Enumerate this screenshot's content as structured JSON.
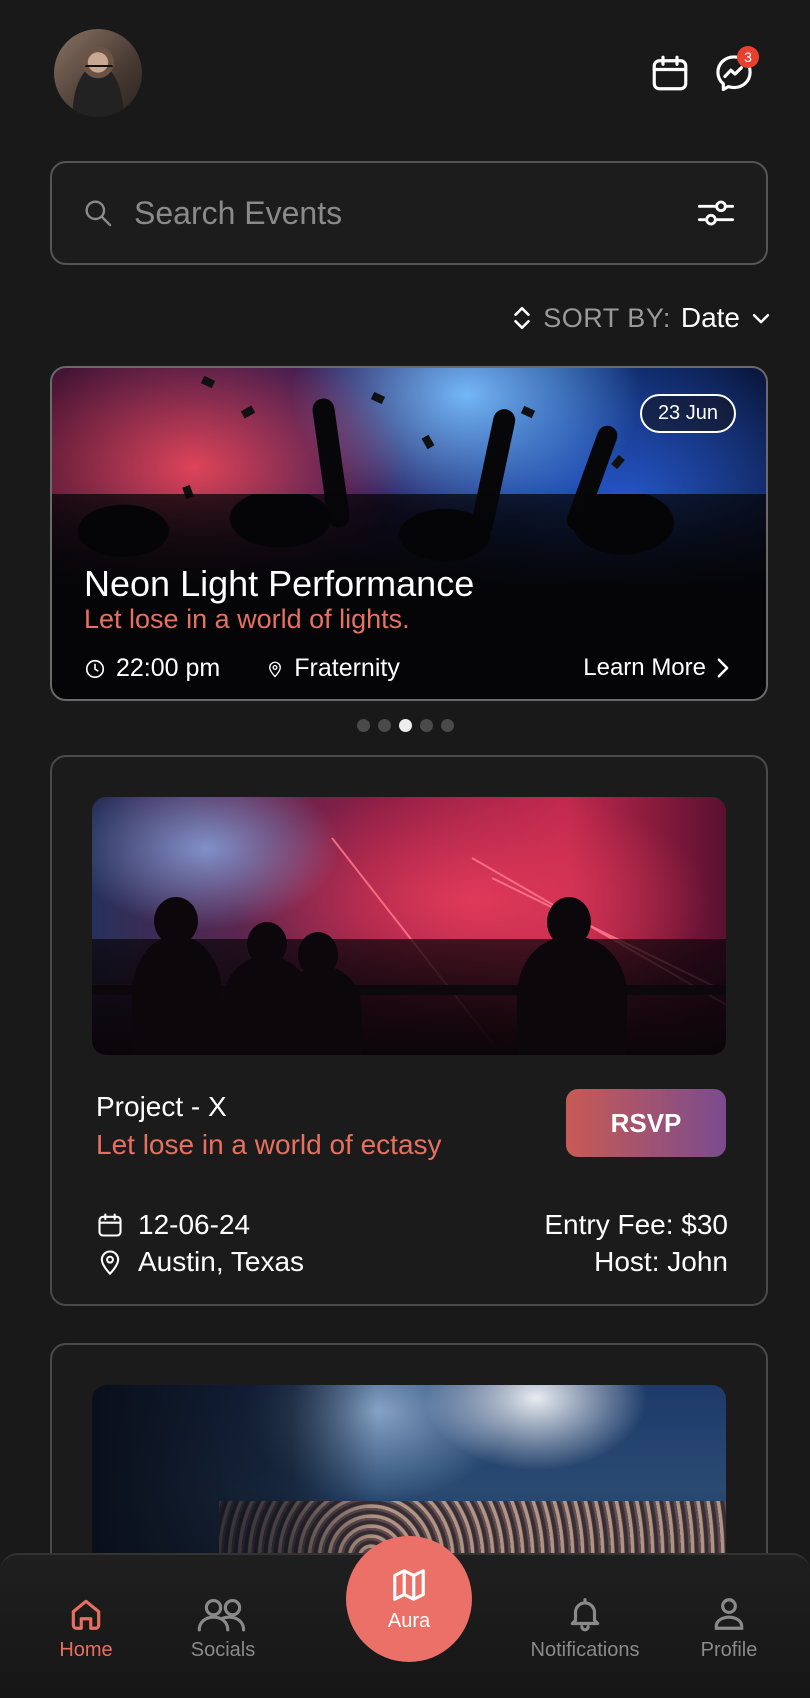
{
  "header": {
    "avatar_alt": "user avatar",
    "message_badge": "3"
  },
  "search": {
    "placeholder": "Search Events"
  },
  "sort": {
    "label": "SORT BY:",
    "value": "Date"
  },
  "featured": {
    "date": "23 Jun",
    "title": "Neon Light Performance",
    "subtitle": "Let lose in a world of lights.",
    "time": "22:00 pm",
    "location": "Fraternity",
    "cta": "Learn More",
    "carousel_total": 5,
    "carousel_active": 3
  },
  "events": [
    {
      "title": "Project - X",
      "subtitle": "Let lose in a world of ectasy",
      "rsvp": "RSVP",
      "date": "12-06-24",
      "location": "Austin, Texas",
      "fee": "Entry Fee: $30",
      "host": "Host: John"
    }
  ],
  "nav": {
    "home": "Home",
    "socials": "Socials",
    "aura": "Aura",
    "notifications": "Notifications",
    "profile": "Profile"
  },
  "colors": {
    "accent": "#e87060",
    "background": "#191919",
    "badge": "#e8402f"
  }
}
